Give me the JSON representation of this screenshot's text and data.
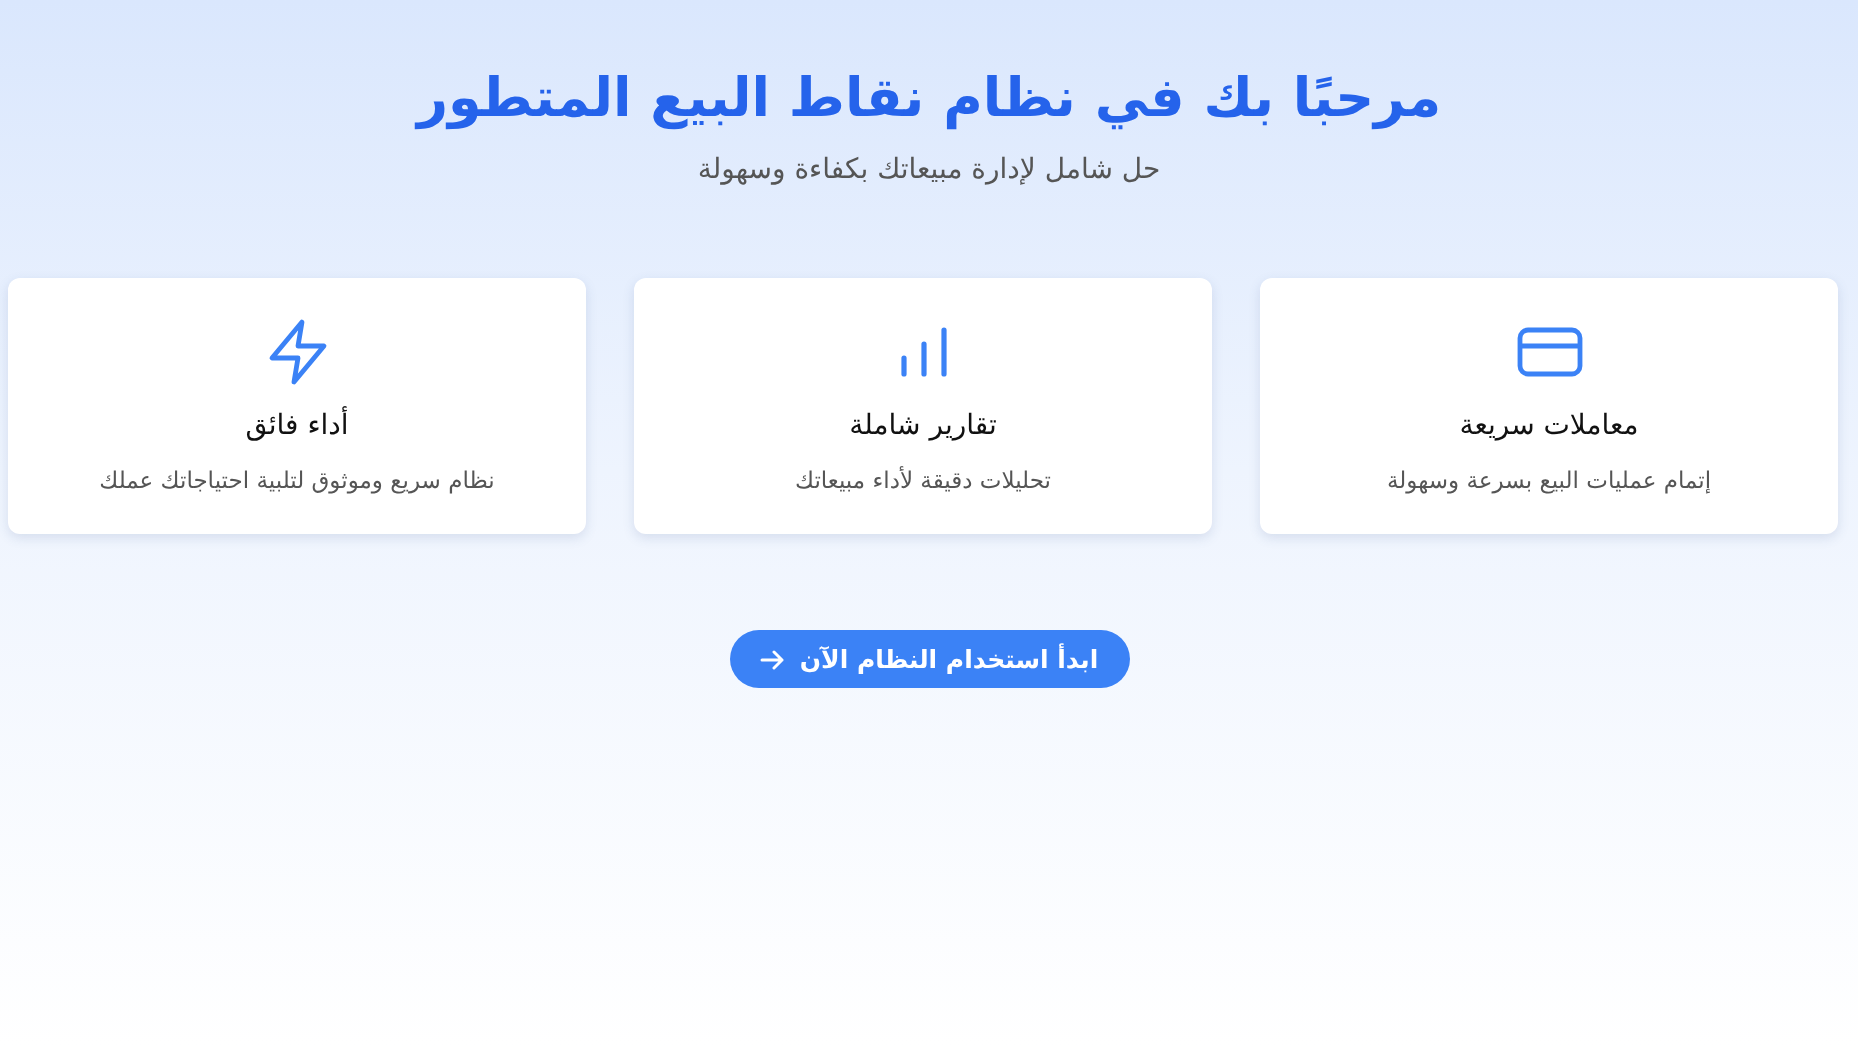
{
  "header": {
    "title": "مرحبًا بك في نظام نقاط البيع المتطور",
    "subtitle": "حل شامل لإدارة مبيعاتك بكفاءة وسهولة"
  },
  "features": [
    {
      "kind": "card",
      "title": "معاملات سريعة",
      "description": "إتمام عمليات البيع بسرعة وسهولة"
    },
    {
      "kind": "chart",
      "title": "تقارير شاملة",
      "description": "تحليلات دقيقة لأداء مبيعاتك"
    },
    {
      "kind": "bolt",
      "title": "أداء فائق",
      "description": "نظام سريع وموثوق لتلبية احتياجاتك عملك"
    }
  ],
  "cta": {
    "label": "ابدأ استخدام النظام الآن"
  }
}
